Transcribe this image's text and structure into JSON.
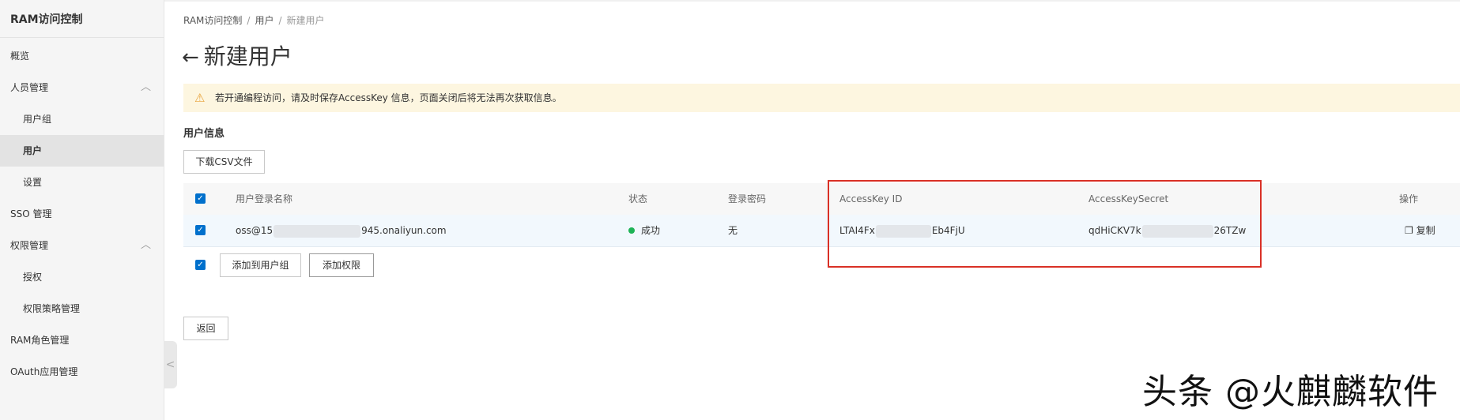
{
  "sidebar": {
    "title": "RAM访问控制",
    "items": [
      {
        "label": "概览"
      },
      {
        "label": "人员管理",
        "chevron": "chevron-up-icon"
      },
      {
        "label": "用户组"
      },
      {
        "label": "用户"
      },
      {
        "label": "设置"
      },
      {
        "label": "SSO 管理"
      },
      {
        "label": "权限管理",
        "chevron": "chevron-up-icon"
      },
      {
        "label": "授权"
      },
      {
        "label": "权限策略管理"
      },
      {
        "label": "RAM角色管理"
      },
      {
        "label": "OAuth应用管理"
      }
    ]
  },
  "breadcrumb": {
    "items": [
      "RAM访问控制",
      "用户",
      "新建用户"
    ],
    "separator": "/"
  },
  "page": {
    "back_icon": "←",
    "title": "新建用户"
  },
  "alert": {
    "icon": "⚠",
    "message": "若开通编程访问，请及时保存AccessKey 信息，页面关闭后将无法再次获取信息。"
  },
  "section": {
    "title": "用户信息",
    "download_button": "下载CSV文件"
  },
  "table": {
    "headers": [
      "用户登录名称",
      "状态",
      "登录密码",
      "AccessKey ID",
      "AccessKeySecret",
      "操作"
    ],
    "row": {
      "login_prefix": "oss@15",
      "login_suffix": "945.onaliyun.com",
      "status": "成功",
      "password": "无",
      "access_key_id_prefix": "LTAI4Fx",
      "access_key_id_suffix": "Eb4FjU",
      "access_key_secret_prefix": "qdHiCKV7k",
      "access_key_secret_suffix": "26TZw",
      "action": "复制"
    }
  },
  "footer_actions": {
    "add_to_group": "添加到用户组",
    "add_permission": "添加权限"
  },
  "back_button": "返回",
  "watermark": "头条 @火麒麟软件",
  "colors": {
    "accent": "#0070cc",
    "alert_bg": "#fdf6e0",
    "success": "#1eb356",
    "highlight_box": "#d93026",
    "brand": "#ff6a00"
  }
}
